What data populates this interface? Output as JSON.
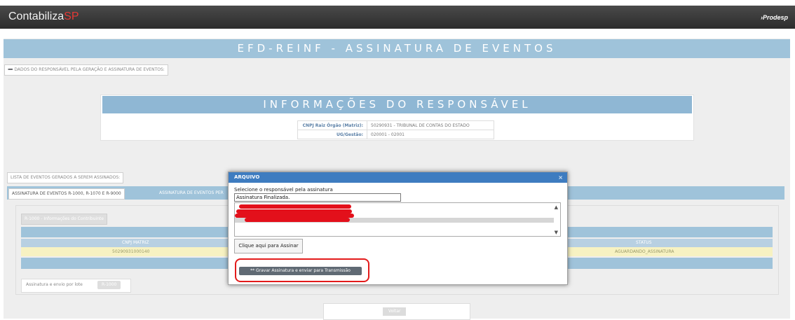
{
  "header": {
    "logo_main": "Contabiliza",
    "logo_accent": "SP",
    "brand_right": "Prodesp",
    "brand_icon": "chevron-arrow-icon"
  },
  "banner": {
    "title": "EFD-REINF - ASSINATURA DE EVENTOS"
  },
  "responsavel": {
    "legend": "➖ DADOS DO RESPONSÁVEL PELA GERAÇÃO E ASSINATURA DE EVENTOS:",
    "title": "INFORMAÇÕES DO RESPONSÁVEL",
    "rows": [
      {
        "key": "CNPJ Raiz Órgão (Matriz):",
        "value": "50290931 - TRIBUNAL DE CONTAS DO ESTADO"
      },
      {
        "key": "UG/Gestão:",
        "value": "020001 - 02001"
      }
    ]
  },
  "lista": {
    "legend": "LISTA DE EVENTOS GERADOS A SEREM ASSINADOS:",
    "tabs": [
      {
        "label": "ASSINATURA DE EVENTOS R-1000, R-1070 E R-9000"
      },
      {
        "label": "ASSINATURA DE EVENTOS PER"
      }
    ],
    "sub_legend": "R-1000 - Informações do Contribuinte",
    "columns": {
      "left": "CNPJ MATRIZ",
      "right": "STATUS"
    },
    "row": {
      "cnpj": "50290931000140",
      "status": "AGUARDANDO_ASSINATURA"
    },
    "lote_label": "Assinatura e envio por lote",
    "lote_button": "R-1000"
  },
  "footer": {
    "back_button": "Voltar"
  },
  "modal": {
    "title": "ARQUIVO",
    "close_glyph": "×",
    "select_label": "Selecione o responsável pela assinatura",
    "status_value": "Assinatura Finalizada.",
    "sign_button": "Clique aqui para Assinar",
    "save_button": "** Gravar Assinatura e enviar para Transmissão",
    "highlight_color": "#e31b1b",
    "header_color": "#3e7cc0"
  }
}
